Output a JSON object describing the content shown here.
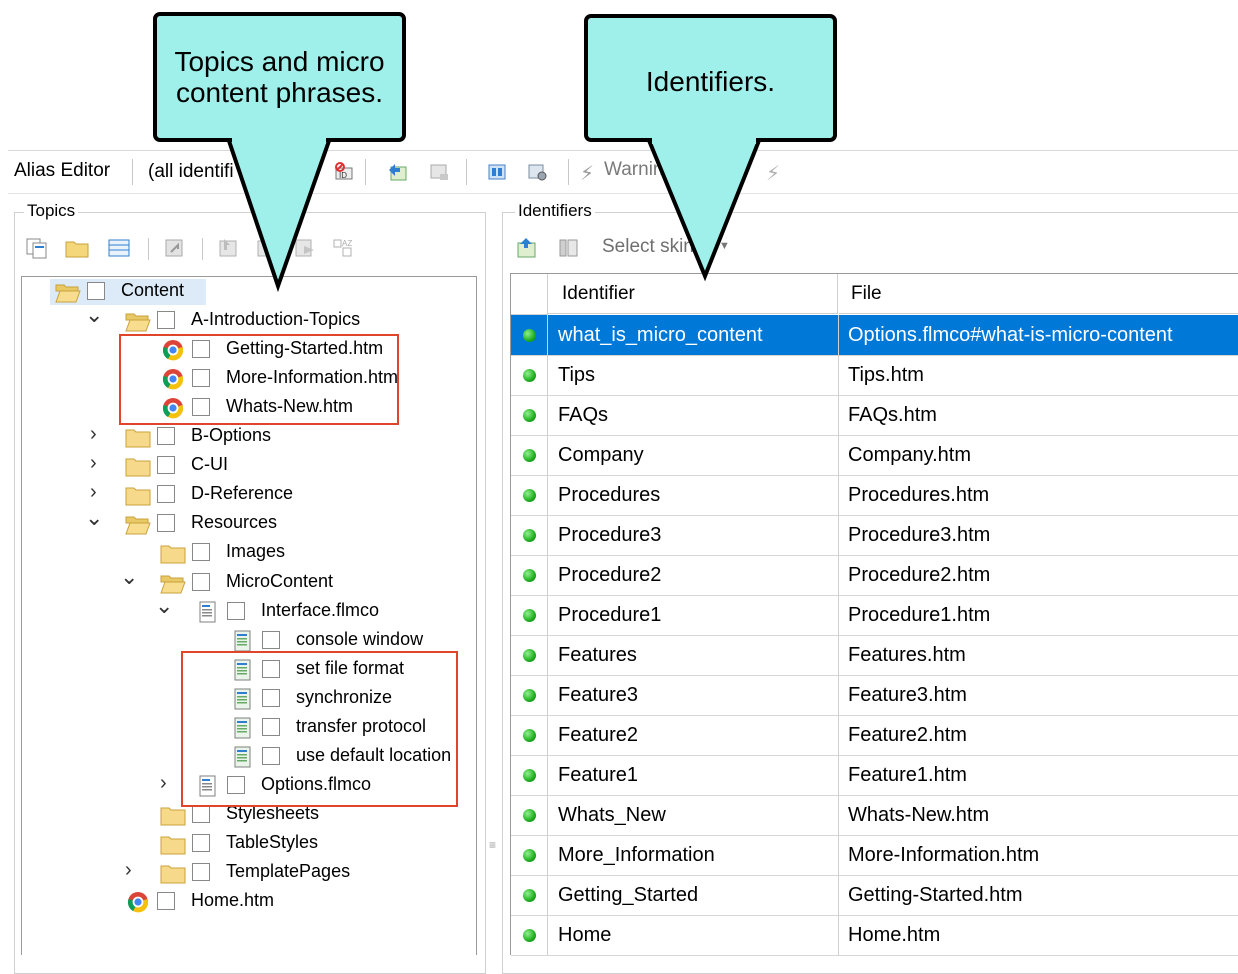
{
  "toolbar": {
    "title": "Alias Editor",
    "filter_value": "(all identifi",
    "warning_label": "Warnin"
  },
  "topics_panel": {
    "label": "Topics",
    "tree": [
      {
        "label": "Content",
        "icon": "folder-open-icon",
        "expander": "none"
      },
      {
        "label": "A-Introduction-Topics",
        "icon": "folder-open-icon",
        "expander": "expanded"
      },
      {
        "label": "Getting-Started.htm",
        "icon": "chrome-icon",
        "expander": "none"
      },
      {
        "label": "More-Information.htm",
        "icon": "chrome-icon",
        "expander": "none"
      },
      {
        "label": "Whats-New.htm",
        "icon": "chrome-icon",
        "expander": "none"
      },
      {
        "label": "B-Options",
        "icon": "folder-icon",
        "expander": "collapsed"
      },
      {
        "label": "C-UI",
        "icon": "folder-icon",
        "expander": "collapsed"
      },
      {
        "label": "D-Reference",
        "icon": "folder-icon",
        "expander": "collapsed"
      },
      {
        "label": "Resources",
        "icon": "folder-open-icon",
        "expander": "expanded"
      },
      {
        "label": "Images",
        "icon": "folder-icon",
        "expander": "none"
      },
      {
        "label": "MicroContent",
        "icon": "folder-open-icon",
        "expander": "expanded"
      },
      {
        "label": "Interface.flmco",
        "icon": "micro-content-file-icon",
        "expander": "expanded"
      },
      {
        "label": "console window",
        "icon": "micro-content-phrase-icon",
        "expander": "none"
      },
      {
        "label": "set file format",
        "icon": "micro-content-phrase-icon",
        "expander": "none"
      },
      {
        "label": "synchronize",
        "icon": "micro-content-phrase-icon",
        "expander": "none"
      },
      {
        "label": "transfer protocol",
        "icon": "micro-content-phrase-icon",
        "expander": "none"
      },
      {
        "label": "use default location",
        "icon": "micro-content-phrase-icon",
        "expander": "none"
      },
      {
        "label": "Options.flmco",
        "icon": "micro-content-file-icon",
        "expander": "collapsed"
      },
      {
        "label": "Stylesheets",
        "icon": "folder-icon",
        "expander": "none"
      },
      {
        "label": "TableStyles",
        "icon": "folder-icon",
        "expander": "none"
      },
      {
        "label": "TemplatePages",
        "icon": "folder-icon",
        "expander": "collapsed"
      },
      {
        "label": "Home.htm",
        "icon": "chrome-icon",
        "expander": "none"
      }
    ]
  },
  "identifiers_panel": {
    "label": "Identifiers",
    "skin_placeholder": "Select skin",
    "columns": [
      "Identifier",
      "File"
    ],
    "rows": [
      {
        "identifier": "what_is_micro_content",
        "file": "Options.flmco#what-is-micro-content",
        "selected": true
      },
      {
        "identifier": "Tips",
        "file": "Tips.htm",
        "selected": false
      },
      {
        "identifier": "FAQs",
        "file": "FAQs.htm",
        "selected": false
      },
      {
        "identifier": "Company",
        "file": "Company.htm",
        "selected": false
      },
      {
        "identifier": "Procedures",
        "file": "Procedures.htm",
        "selected": false
      },
      {
        "identifier": "Procedure3",
        "file": "Procedure3.htm",
        "selected": false
      },
      {
        "identifier": "Procedure2",
        "file": "Procedure2.htm",
        "selected": false
      },
      {
        "identifier": "Procedure1",
        "file": "Procedure1.htm",
        "selected": false
      },
      {
        "identifier": "Features",
        "file": "Features.htm",
        "selected": false
      },
      {
        "identifier": "Feature3",
        "file": "Feature3.htm",
        "selected": false
      },
      {
        "identifier": "Feature2",
        "file": "Feature2.htm",
        "selected": false
      },
      {
        "identifier": "Feature1",
        "file": "Feature1.htm",
        "selected": false
      },
      {
        "identifier": "Whats_New",
        "file": "Whats-New.htm",
        "selected": false
      },
      {
        "identifier": "More_Information",
        "file": "More-Information.htm",
        "selected": false
      },
      {
        "identifier": "Getting_Started",
        "file": "Getting-Started.htm",
        "selected": false
      },
      {
        "identifier": "Home",
        "file": "Home.htm",
        "selected": false
      }
    ]
  },
  "callouts": {
    "topics": "Topics and micro content phrases.",
    "identifiers": "Identifiers."
  },
  "colors": {
    "callout_fill": "#9ff0ea",
    "highlight_border": "#e0452c",
    "selection": "#0078d7"
  }
}
